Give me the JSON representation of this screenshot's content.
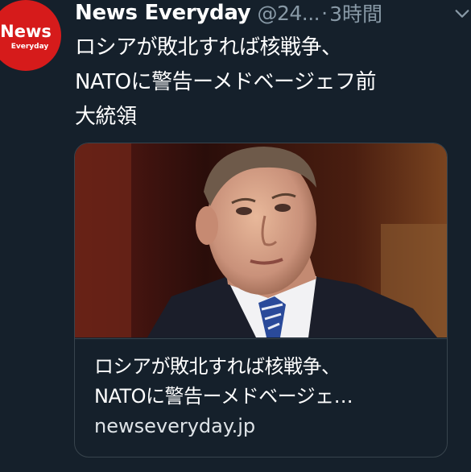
{
  "tweet": {
    "avatar": {
      "name": "News",
      "sub": "Everyday",
      "color": "#d61b1b"
    },
    "display_name": "News Everyday",
    "handle": "@24...",
    "separator": "·",
    "timestamp": "3時間",
    "menu_icon": "chevron-down-icon",
    "text_lines": [
      "ロシアが敗北すれば核戦争、",
      "NATOに警告ーメドベージェフ前",
      "大統領"
    ],
    "card": {
      "image_icon": "photo-man-in-suit",
      "title_lines": [
        "ロシアが敗北すれば核戦争、",
        "NATOに警告ーメドベージェ…"
      ],
      "domain": "newseveryday.jp"
    }
  },
  "colors": {
    "background": "#15202b",
    "secondary_text": "#8899a6",
    "border": "#38444d"
  }
}
